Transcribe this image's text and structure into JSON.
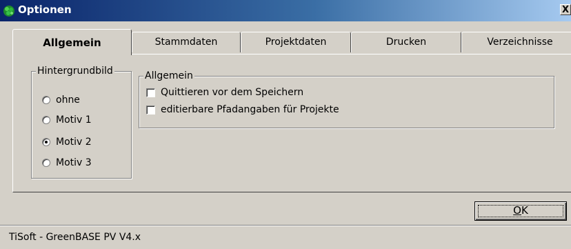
{
  "window": {
    "title": "Optionen",
    "close_label": "X",
    "title_gradient": [
      "#0a246a",
      "#a6caf0"
    ],
    "face_color": "#d4d0c8"
  },
  "tabs": [
    {
      "label": "Allgemein",
      "active": true
    },
    {
      "label": "Stammdaten",
      "active": false
    },
    {
      "label": "Projektdaten",
      "active": false
    },
    {
      "label": "Drucken",
      "active": false
    },
    {
      "label": "Verzeichnisse",
      "active": false
    }
  ],
  "hintergrund": {
    "legend": "Hintergrundbild",
    "options": [
      {
        "label": "ohne",
        "selected": false
      },
      {
        "label": "Motiv 1",
        "selected": false
      },
      {
        "label": "Motiv 2",
        "selected": true
      },
      {
        "label": "Motiv 3",
        "selected": false
      }
    ]
  },
  "allgemein": {
    "legend": "Allgemein",
    "options": [
      {
        "label": "Quittieren vor dem Speichern",
        "checked": false
      },
      {
        "label": "editierbare Pfadangaben für Projekte",
        "checked": false
      }
    ]
  },
  "ok_button": {
    "prefix": "",
    "accel": "O",
    "suffix": "K"
  },
  "status": {
    "text": "TiSoft - GreenBASE PV V4.x"
  }
}
